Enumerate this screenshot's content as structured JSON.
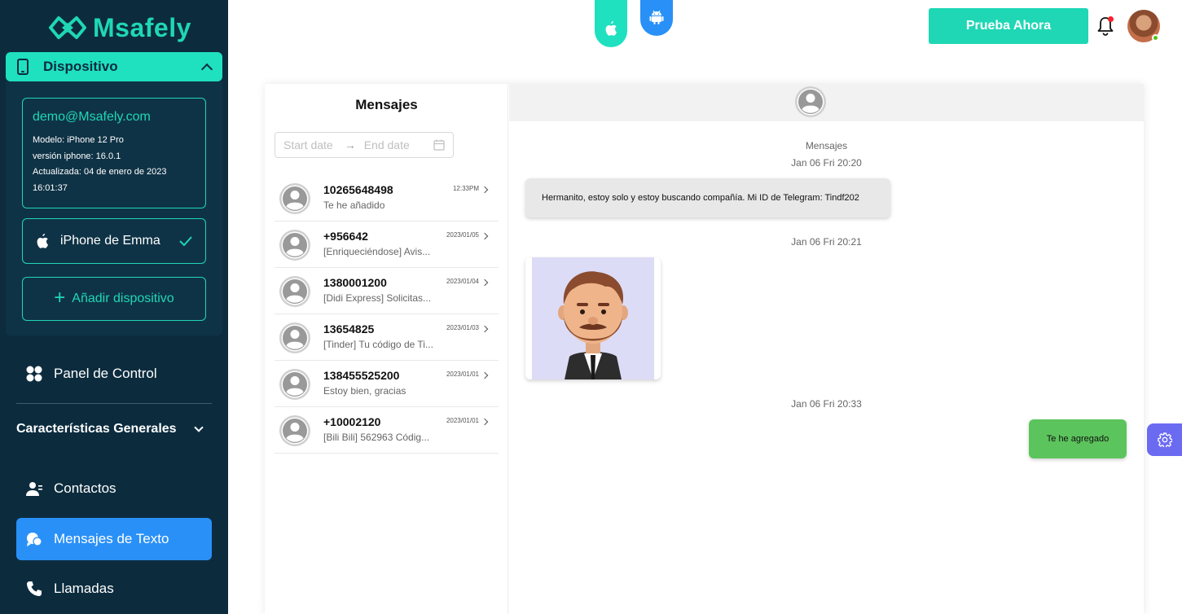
{
  "app": {
    "brand": "Msafely",
    "brand_color": "#1fd7b5",
    "sidebar_bg": "#0c2c3e",
    "active_color": "#2990f7"
  },
  "sidebar": {
    "device_header": "Dispositivo",
    "device_info": {
      "email": "demo@Msafely.com",
      "model": "Modelo: iPhone 12 Pro",
      "version": "versión iphone: 16.0.1",
      "updated": "Actualizada: 04 de enero de 2023",
      "updated_time": "16:01:37"
    },
    "device_name": "iPhone de Emma",
    "add_device": "Añadir dispositivo",
    "dashboard": "Panel de Control",
    "section_title": "Características Generales",
    "items": [
      {
        "label": "Contactos",
        "icon": "contacts-icon"
      },
      {
        "label": "Mensajes de Texto",
        "icon": "messages-icon",
        "active": true
      },
      {
        "label": "Llamadas",
        "icon": "phone-icon"
      }
    ]
  },
  "topbar": {
    "os_tabs": [
      {
        "name": "iOS",
        "icon": "apple-icon",
        "selected": true
      },
      {
        "name": "Android",
        "icon": "android-icon"
      }
    ],
    "try_button": "Prueba Ahora",
    "has_notification": true
  },
  "messages_list": {
    "title": "Mensajes",
    "start_placeholder": "Start date",
    "end_placeholder": "End date",
    "items": [
      {
        "number": "10265648498",
        "preview": "Te he añadido",
        "time": "12:33PM"
      },
      {
        "number": "+956642",
        "preview": "[Enriqueciéndose] Avis...",
        "time": "2023/01/05"
      },
      {
        "number": "1380001200",
        "preview": "[Didi Express] Solicitas...",
        "time": "2023/01/04"
      },
      {
        "number": "13654825",
        "preview": "[Tinder] Tu código de Ti...",
        "time": "2023/01/03"
      },
      {
        "number": "138455525200",
        "preview": "Estoy bien, gracias",
        "time": "2023/01/01"
      },
      {
        "number": "+10002120",
        "preview": "[Bili Bili] 562963 Códig...",
        "time": "2023/01/01"
      }
    ]
  },
  "chat": {
    "label": "Mensajes",
    "timestamps": [
      "Jan 06 Fri 20:20",
      "Jan 06 Fri 20:21",
      "Jan 06 Fri 20:33"
    ],
    "incoming_text": "Hermanito, estoy solo y estoy buscando compañía. Mi ID de Telegram: Tindf202",
    "outgoing_text": "Te he agregado",
    "outgoing_color": "#5cc45c"
  }
}
